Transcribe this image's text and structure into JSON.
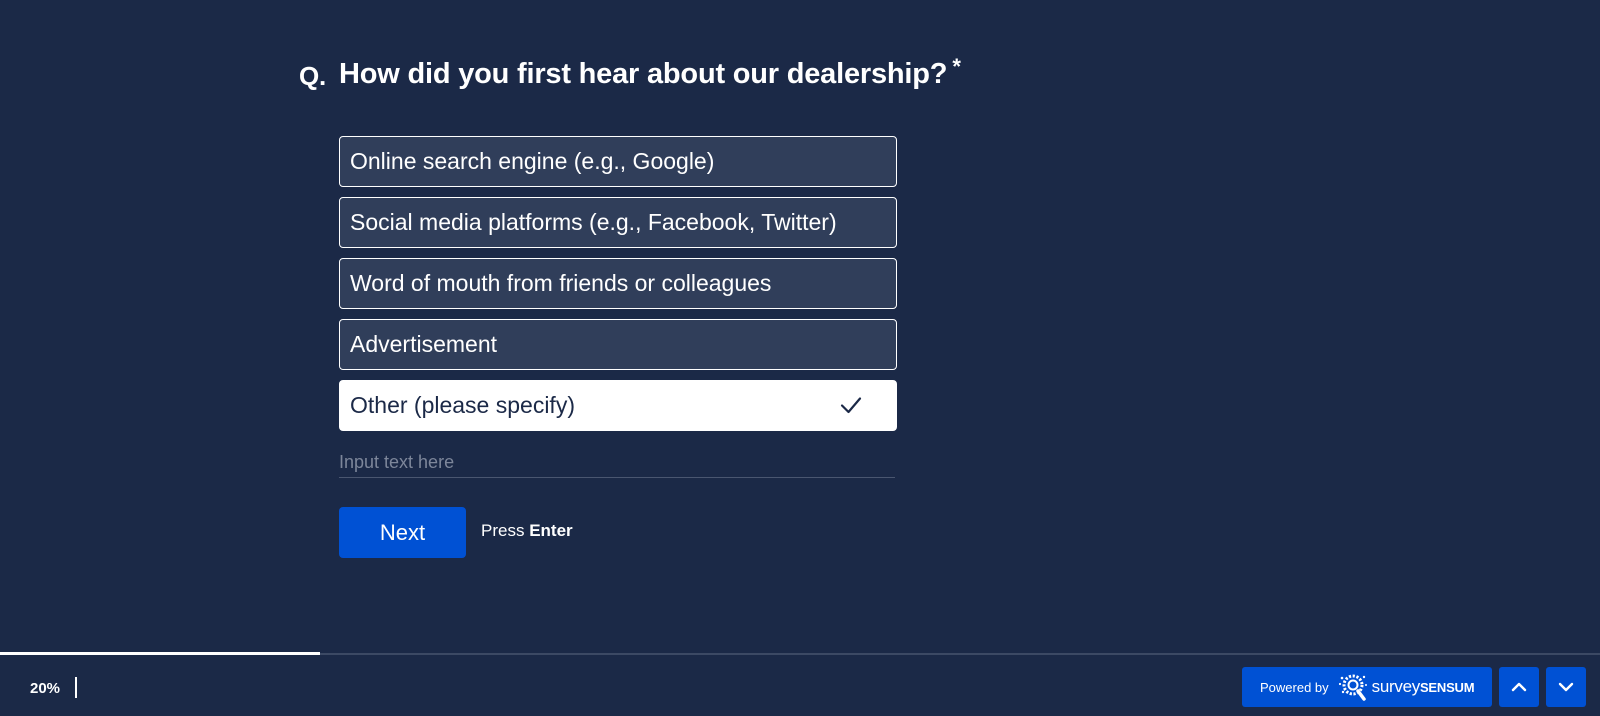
{
  "question": {
    "prefix": "Q.",
    "text": "How did you first hear about our dealership?",
    "required_marker": "*"
  },
  "options": [
    {
      "label": "Online search engine (e.g., Google)",
      "selected": false
    },
    {
      "label": "Social media platforms (e.g., Facebook, Twitter)",
      "selected": false
    },
    {
      "label": "Word of mouth from friends or colleagues",
      "selected": false
    },
    {
      "label": "Advertisement",
      "selected": false
    },
    {
      "label": "Other (please specify)",
      "selected": true
    }
  ],
  "other_input": {
    "value": "",
    "placeholder": "Input text here"
  },
  "actions": {
    "next_label": "Next",
    "hint_prefix": "Press",
    "hint_key": "Enter"
  },
  "progress": {
    "percent": 20,
    "label": "20%"
  },
  "footer": {
    "powered_by": "Powered by",
    "brand_light": "survey",
    "brand_bold": "SENSUM"
  },
  "colors": {
    "background": "#1b2947",
    "option_background": "#303e5a",
    "accent": "#0051d4",
    "selected_background": "#ffffff"
  },
  "icons": {
    "selected_check": "checkmark-icon",
    "nav_up": "chevron-up-icon",
    "nav_down": "chevron-down-icon",
    "brand_logo": "surveysensum-logo-icon"
  }
}
